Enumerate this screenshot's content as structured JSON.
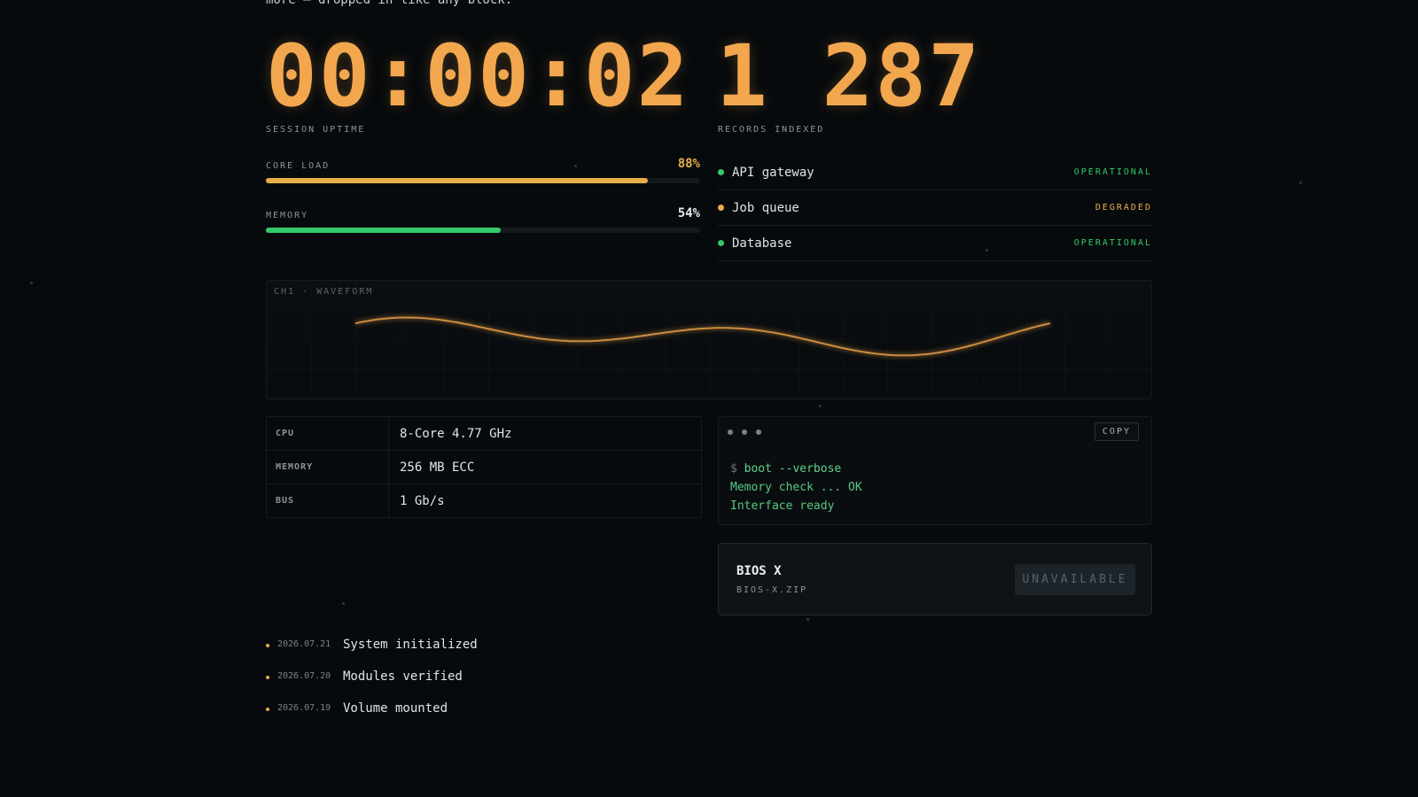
{
  "intro": "more — dropped in like any block.",
  "counters": {
    "uptime": {
      "value": "00:00:02",
      "label": "SESSION UPTIME"
    },
    "records": {
      "value": "1 287",
      "label": "RECORDS INDEXED"
    }
  },
  "meters": [
    {
      "label": "CORE LOAD",
      "value_text": "88%",
      "value": 88,
      "color": "#e8ad48"
    },
    {
      "label": "MEMORY",
      "value_text": "54%",
      "value": 54,
      "color": "#35c86a"
    }
  ],
  "services": [
    {
      "name": "API gateway",
      "state": "OPERATIONAL",
      "color": "#35c86a"
    },
    {
      "name": "Job queue",
      "state": "DEGRADED",
      "color": "#e8ad48"
    },
    {
      "name": "Database",
      "state": "OPERATIONAL",
      "color": "#35c86a"
    }
  ],
  "waveform": {
    "label": "CH1 · WAVEFORM",
    "color": "#e39a45"
  },
  "specs": [
    {
      "key": "CPU",
      "value": "8-Core 4.77 GHz"
    },
    {
      "key": "MEMORY",
      "value": "256 MB ECC"
    },
    {
      "key": "BUS",
      "value": "1 Gb/s"
    }
  ],
  "terminal": {
    "copy_label": "COPY",
    "prompt": "$",
    "command": "boot --verbose",
    "output": [
      "Memory check ... OK",
      "Interface ready"
    ]
  },
  "download": {
    "title": "BIOS X",
    "file": "BIOS-X.ZIP",
    "button_label": "UNAVAILABLE"
  },
  "log": [
    {
      "date": "2026.07.21",
      "text": "System initialized"
    },
    {
      "date": "2026.07.20",
      "text": "Modules verified"
    },
    {
      "date": "2026.07.19",
      "text": "Volume mounted"
    }
  ],
  "colors": {
    "accent": "#f2a74e",
    "ok": "#35c86a",
    "warn": "#e8ad48",
    "bg": "#070a0c"
  }
}
